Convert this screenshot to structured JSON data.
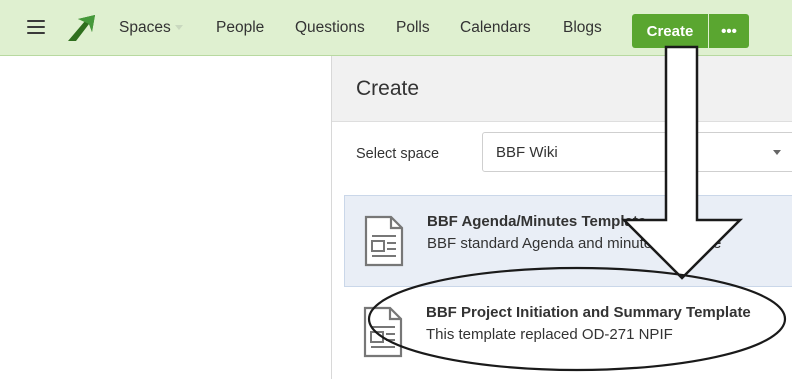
{
  "topbar": {
    "menu_icon": "hamburger-menu-icon",
    "logo_icon": "arrow-logo-icon",
    "nav": [
      {
        "label": "Spaces",
        "has_caret": true
      },
      {
        "label": "People"
      },
      {
        "label": "Questions"
      },
      {
        "label": "Polls"
      },
      {
        "label": "Calendars"
      },
      {
        "label": "Blogs"
      }
    ],
    "create_label": "Create",
    "more_label": "•••",
    "accent_color": "#5aa630",
    "bar_color": "#dff0d0"
  },
  "panel": {
    "title": "Create",
    "space_label": "Select space",
    "space_value": "BBF Wiki",
    "templates": [
      {
        "title": "BBF Agenda/Minutes Template",
        "description": "BBF standard Agenda and minutes template",
        "icon": "document-template-icon",
        "selected": true
      },
      {
        "title": "BBF Project Initiation and Summary Template",
        "description": "This template replaced OD-271 NPIF",
        "icon": "document-template-icon",
        "selected": false
      }
    ]
  },
  "annotations": {
    "arrow": "down-arrow-annotation",
    "ellipse": "highlight-ellipse-annotation"
  }
}
